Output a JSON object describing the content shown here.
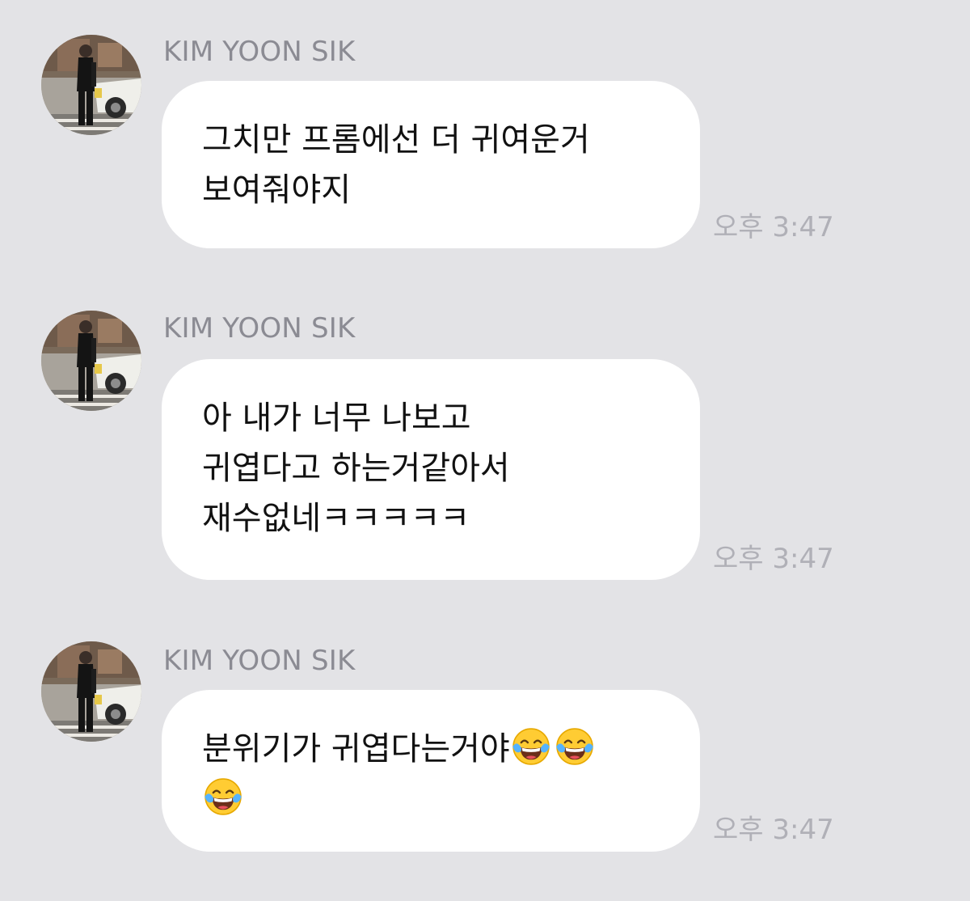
{
  "messages": [
    {
      "sender": "KIM YOON SIK",
      "lines": [
        "그치만 프롬에선 더 귀여운거",
        "보여줘야지"
      ],
      "time": "오후 3:47"
    },
    {
      "sender": "KIM YOON SIK",
      "lines": [
        "아 내가 너무 나보고",
        "귀엽다고 하는거같아서",
        "재수없네ㅋㅋㅋㅋㅋ"
      ],
      "time": "오후 3:47"
    },
    {
      "sender": "KIM YOON SIK",
      "lines": [
        "분위기가 귀엽다는거야"
      ],
      "emoji_name": "face-with-tears-of-joy-icon",
      "time": "오후 3:47"
    }
  ],
  "colors": {
    "background": "#e3e3e6",
    "bubble": "#ffffff",
    "sender_text": "#8b8b93",
    "time_text": "#b0b0b7",
    "message_text": "#111111"
  }
}
